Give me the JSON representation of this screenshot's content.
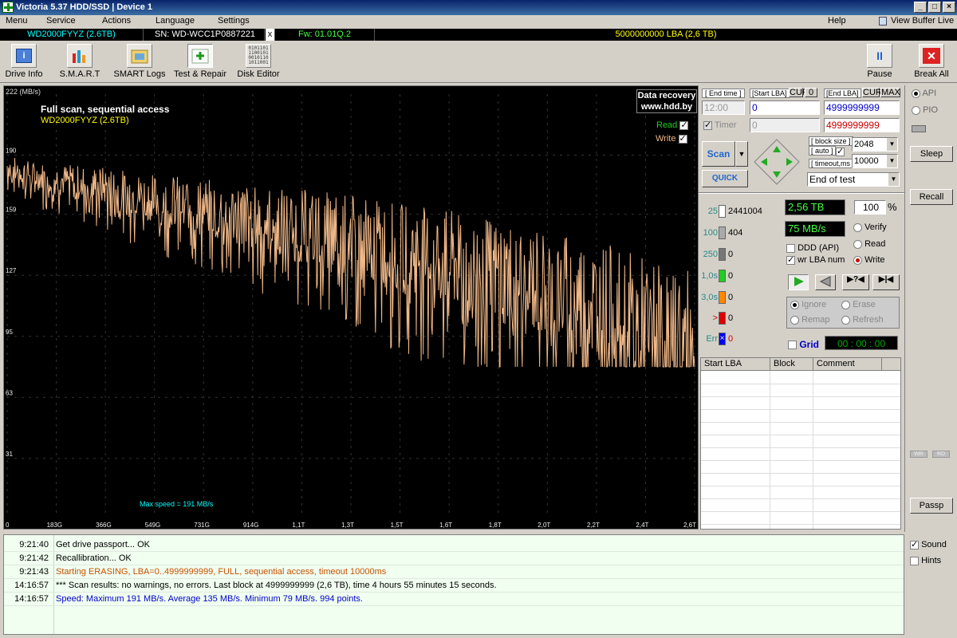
{
  "window": {
    "title": "Victoria 5.37 HDD/SSD | Device 1"
  },
  "menu": {
    "items": [
      "Menu",
      "Service",
      "Actions",
      "Language",
      "Settings"
    ],
    "help": "Help",
    "view_buffer": "View Buffer Live"
  },
  "infobar": {
    "model": "WD2000FYYZ (2.6TB)",
    "serial": "SN: WD-WCC1P0887221",
    "close": "x",
    "firmware": "Fw: 01.01Q.2",
    "lba": "5000000000 LBA (2,6 TB)"
  },
  "toolbar": {
    "buttons": [
      "Drive Info",
      "S.M.A.R.T",
      "SMART Logs",
      "Test & Repair",
      "Disk Editor"
    ],
    "pause": "Pause",
    "break_all": "Break All"
  },
  "graph": {
    "y_unit": "222 (MB/s)",
    "title": "Full scan, sequential access",
    "drive": "WD2000FYYZ (2.6TB)",
    "data_recovery_line1": "Data recovery",
    "data_recovery_line2": "www.hdd.by",
    "read_label": "Read",
    "write_label": "Write",
    "max_speed": "Max speed = 191 MB/s",
    "y_ticks": [
      "190",
      "159",
      "127",
      "95",
      "63",
      "31"
    ],
    "x_ticks": [
      "0",
      "183G",
      "366G",
      "549G",
      "731G",
      "914G",
      "1,1T",
      "1,3T",
      "1,5T",
      "1,6T",
      "1,8T",
      "2,0T",
      "2,2T",
      "2,4T",
      "2,6T"
    ]
  },
  "chart_data": {
    "type": "line",
    "title": "Full scan, sequential access",
    "xlabel": "",
    "ylabel": "MB/s",
    "ylim": [
      0,
      222
    ],
    "x_ticks": [
      "0",
      "183G",
      "366G",
      "549G",
      "731G",
      "914G",
      "1,1T",
      "1,3T",
      "1,5T",
      "1,6T",
      "1,8T",
      "2,0T",
      "2,2T",
      "2,4T",
      "2,6T"
    ],
    "series": [
      {
        "name": "Write",
        "color": "#f0b888",
        "x_tb": [
          0,
          0.1,
          0.2,
          0.3,
          0.4,
          0.5,
          0.6,
          0.7,
          0.8,
          0.9,
          1.0,
          1.1,
          1.2,
          1.3,
          1.4,
          1.5,
          1.6,
          1.7,
          1.8,
          1.9,
          2.0,
          2.1,
          2.2,
          2.3,
          2.4,
          2.5,
          2.6
        ],
        "y_mbs": [
          185,
          180,
          178,
          176,
          174,
          170,
          168,
          166,
          163,
          160,
          158,
          155,
          153,
          150,
          146,
          143,
          140,
          137,
          133,
          130,
          126,
          122,
          117,
          112,
          106,
          100,
          95
        ]
      }
    ],
    "summary": {
      "max": 191,
      "avg": 135,
      "min": 79
    }
  },
  "controls": {
    "end_time_label": "[ End time ]",
    "start_lba_label": "[Start LBA]",
    "cur_btn": "CUR",
    "zero_btn": "0",
    "end_lba_label": "[End LBA]",
    "cur2_btn": "CUR",
    "max_btn": "MAX",
    "time_value": "12:00",
    "start_lba": "0",
    "end_lba": "4999999999",
    "timer_label": "Timer",
    "timer_value": "0",
    "end_lba2": "4999999999",
    "scan_btn": "Scan",
    "quick_btn": "QUICK",
    "block_size_label": "[ block size ]",
    "auto_label": "[ auto ]",
    "block_size": "2048",
    "timeout_label": "[ timeout,ms ]",
    "timeout": "10000",
    "end_of_test": "End of test"
  },
  "stats": {
    "rows": [
      {
        "label": "25",
        "value": "2441004",
        "color": "#fff"
      },
      {
        "label": "100",
        "value": "404",
        "color": "#aaa"
      },
      {
        "label": "250",
        "value": "0",
        "color": "#777"
      },
      {
        "label": "1,0s",
        "value": "0",
        "color": "#22cc22"
      },
      {
        "label": "3,0s",
        "value": "0",
        "color": "#ff8800"
      },
      {
        "label": ">",
        "value": "0",
        "color": "#dd0000"
      },
      {
        "label": "Err",
        "value": "0",
        "color": "#0000ee"
      }
    ],
    "size": "2,56 TB",
    "percent": "100",
    "pct_sign": "%",
    "speed": "75 MB/s",
    "verify": "Verify",
    "read": "Read",
    "write": "Write",
    "ddd": "DDD (API)",
    "wr_lba": "wr LBA num",
    "ignore": "Ignore",
    "erase": "Erase",
    "remap": "Remap",
    "refresh": "Refresh",
    "grid": "Grid",
    "timer": "00 : 00 : 00"
  },
  "table": {
    "headers": [
      "Start LBA",
      "Block",
      "Comment"
    ]
  },
  "side": {
    "api": "API",
    "pio": "PIO",
    "sleep": "Sleep",
    "recall": "Recall",
    "wr": "WR",
    "rd": "RD",
    "passp": "Passp",
    "sound": "Sound",
    "hints": "Hints"
  },
  "log": [
    {
      "time": "9:21:40",
      "msg": "Get drive passport... OK",
      "color": "#000"
    },
    {
      "time": "9:21:42",
      "msg": "Recallibration... OK",
      "color": "#000"
    },
    {
      "time": "9:21:43",
      "msg": "Starting ERASING, LBA=0..4999999999, FULL, sequential access, timeout 10000ms",
      "color": "#c85000"
    },
    {
      "time": "14:16:57",
      "msg": "*** Scan results: no warnings, no errors. Last block at 4999999999 (2,6 TB), time 4 hours 55 minutes 15 seconds.",
      "color": "#000"
    },
    {
      "time": "14:16:57",
      "msg": "Speed: Maximum 191 MB/s. Average 135 MB/s. Minimum 79 MB/s. 994 points.",
      "color": "#0000cc"
    }
  ]
}
